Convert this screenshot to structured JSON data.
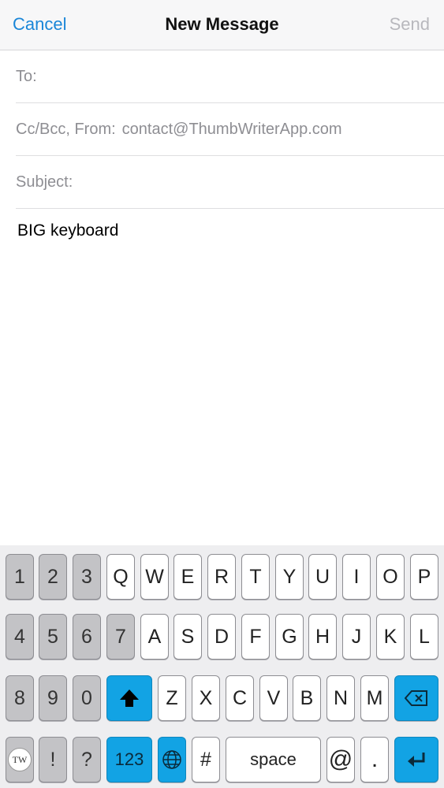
{
  "nav": {
    "cancel": "Cancel",
    "title": "New Message",
    "send": "Send"
  },
  "fields": {
    "to_label": "To:",
    "ccbcc_label": "Cc/Bcc, From:",
    "from_value": "contact@ThumbWriterApp.com",
    "subject_label": "Subject:"
  },
  "body": {
    "text": "BIG keyboard"
  },
  "keyboard": {
    "row1": [
      "1",
      "2",
      "3",
      "Q",
      "W",
      "E",
      "R",
      "T",
      "Y",
      "U",
      "I",
      "O",
      "P"
    ],
    "row2": [
      "4",
      "5",
      "6",
      "7",
      "A",
      "S",
      "D",
      "F",
      "G",
      "H",
      "J",
      "K",
      "L"
    ],
    "row3": [
      "8",
      "9",
      "0",
      "Z",
      "X",
      "C",
      "V",
      "B",
      "N",
      "M"
    ],
    "row4": {
      "tw": "TW",
      "excl": "!",
      "question": "?",
      "num": "123",
      "hash": "#",
      "space": "space",
      "at": "@",
      "dot": "."
    },
    "icons": {
      "shift": "shift-up-arrow-icon",
      "delete": "backspace-icon",
      "globe": "globe-icon",
      "return": "return-arrow-icon"
    },
    "colors": {
      "accent": "#12a3e4",
      "gray_key": "#c3c3c6",
      "link": "#1a86d8"
    }
  }
}
